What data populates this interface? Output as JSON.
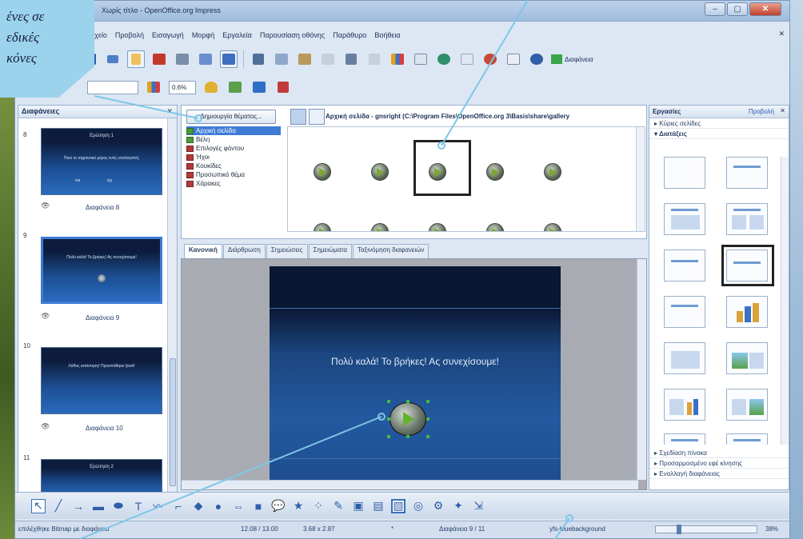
{
  "window": {
    "title": "Χωρίς τίτλο - OpenOffice.org Impress",
    "buttons": [
      "–",
      "▢",
      "✕"
    ]
  },
  "callout": {
    "line1": "ένες σε",
    "line2": "εδικές",
    "line3": "κόνες"
  },
  "menu": [
    "Αρχείο",
    "Προβολή",
    "Εισαγωγή",
    "Μορφή",
    "Εργαλεία",
    "Παρουσίαση οθόνης",
    "Παράθυρο",
    "Βοήθεια"
  ],
  "toolbar": {
    "presentation_label": "Διαφάνεια"
  },
  "toolbar2": {
    "font_combo": "",
    "zoom_combo": "0.6%"
  },
  "slides_pane": {
    "title": "Διαφάνειες",
    "slides": [
      {
        "num": "8",
        "name": "Διαφάνεια 8",
        "heading": "Ερώτηση 1",
        "body": "Ποιο το σημαντικό μέρος ενός υπολογιστή;",
        "a": "ναι",
        "b": "όχι"
      },
      {
        "num": "9",
        "name": "Διαφάνεια 9",
        "body": "Πολύ καλά! Το βρήκες! Ας συνεχίσουμε!"
      },
      {
        "num": "10",
        "name": "Διαφάνεια 10",
        "body": "Λάθος απάντηση! Προσπάθησε ξανά!"
      },
      {
        "num": "11",
        "heading": "Ερώτηση 2"
      }
    ]
  },
  "gallery": {
    "new_theme_button": "Δημιουργία θέματος...",
    "themes": [
      "Αρχική σελίδα",
      "Βέλη",
      "Επιλογές φόντου",
      "Ήχοι",
      "Κουκίδες",
      "Προσωπικό θέμα",
      "Χάρακες"
    ],
    "path": "Αρχική σελίδα - gnsright (C:\\Program Files\\OpenOffice.org 3\\Basis\\share\\gallery"
  },
  "tabs": [
    "Κανονική",
    "Διάρθρωση",
    "Σημειώσεις",
    "Σημειώματα",
    "Ταξινόμηση διαφανειών"
  ],
  "slide": {
    "title": "Πολύ καλά! Το βρήκες! Ας συνεχίσουμε!"
  },
  "tasks": {
    "title": "Εργασίες",
    "view_menu": "Προβολή",
    "sections_top": [
      "Κύριες σελίδες",
      "Διατάξεις"
    ],
    "sections_bottom": [
      "Σχεδίαση πίνακα",
      "Προσαρμοσμένο εφέ κίνησης",
      "Εναλλαγή διαφάνειας"
    ]
  },
  "status": {
    "left": "επιλέχθηκε Bitmap με διαφάνεια",
    "position": "12.08 / 13.00",
    "size": "3.68 x 2.87",
    "star": "*",
    "slide": "Διαφάνεια 9 / 11",
    "master": "yfs-bluebackground",
    "zoom": "38%"
  }
}
